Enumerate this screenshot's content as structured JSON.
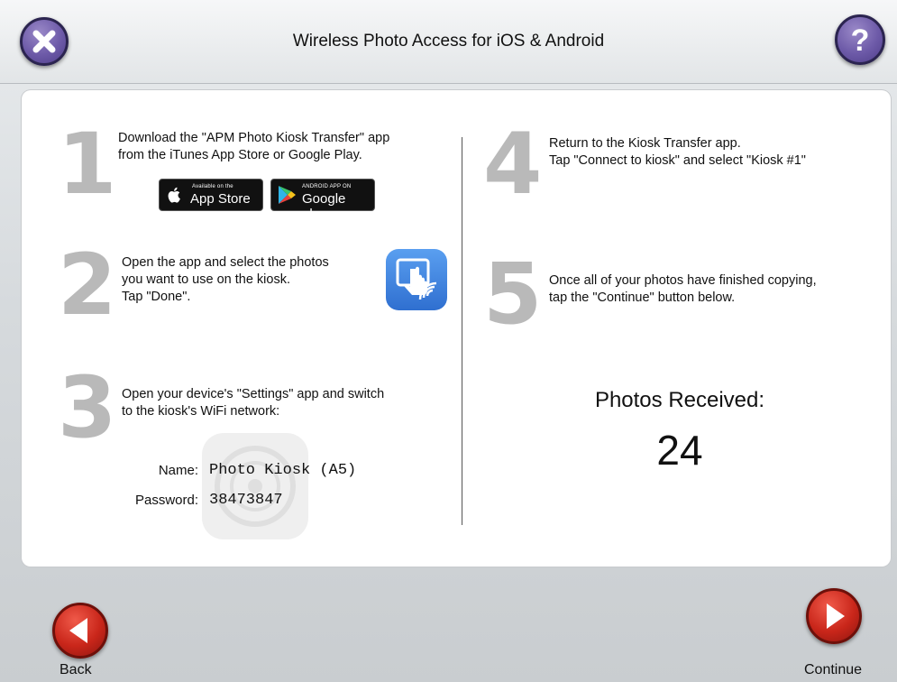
{
  "header": {
    "title": "Wireless Photo Access for iOS & Android",
    "close_icon": "close-icon",
    "help_icon": "help-icon"
  },
  "steps": [
    {
      "number": "1",
      "text_line1": "Download the \"APM Photo Kiosk Transfer\" app",
      "text_line2": "from the iTunes App Store or Google Play."
    },
    {
      "number": "2",
      "text_line1": "Open the app and select the photos",
      "text_line2": "you want to use on the kiosk.",
      "text_line3": "Tap \"Done\"."
    },
    {
      "number": "3",
      "text_line1": "Open your device's \"Settings\" app and switch",
      "text_line2": "to the kiosk's WiFi network:"
    },
    {
      "number": "4",
      "text_line1": "Return to the Kiosk Transfer app.",
      "text_line2": "Tap \"Connect to kiosk\" and select \"Kiosk #1\""
    },
    {
      "number": "5",
      "text_line1": "Once all of your photos have finished copying,",
      "text_line2": "tap the \"Continue\" button below."
    }
  ],
  "badges": {
    "appstore_small": "Available on the",
    "appstore_big": "App Store",
    "googleplay_small": "ANDROID APP ON",
    "googleplay_big": "Google play"
  },
  "wifi": {
    "name_label": "Name:",
    "name_value": "Photo Kiosk (A5)",
    "password_label": "Password:",
    "password_value": "38473847"
  },
  "received": {
    "label": "Photos Received:",
    "count": "24"
  },
  "nav": {
    "back_label": "Back",
    "continue_label": "Continue"
  }
}
